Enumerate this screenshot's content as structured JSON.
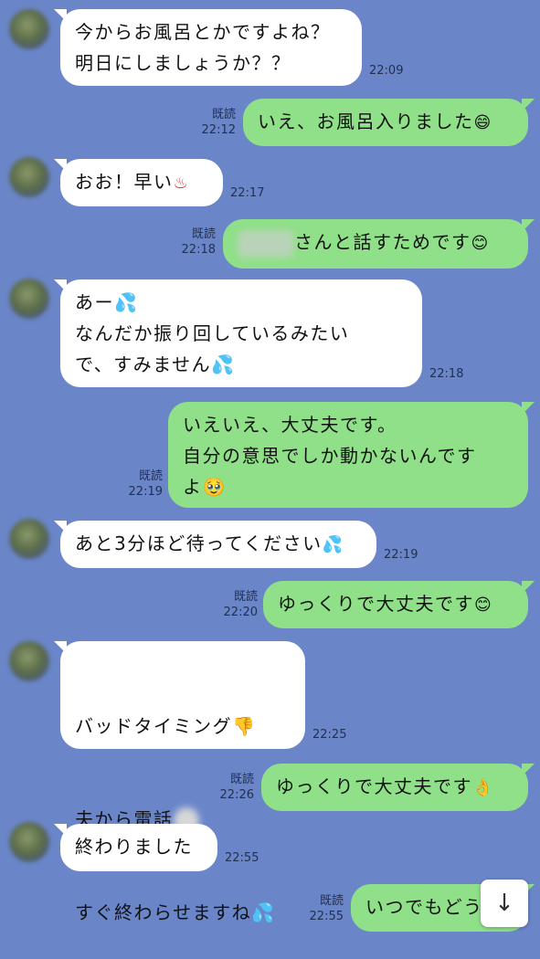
{
  "messages": [
    {
      "lines": "今からお風呂とかですよね？\n明日にしましょうか？？",
      "time": "22:09"
    },
    {
      "text": "いえ、お風呂入りました",
      "emoji": "😄",
      "read": "既読",
      "time": "22:12"
    },
    {
      "text": "おお！早い",
      "emoji": "♨",
      "time": "22:17"
    },
    {
      "text": "さんと話すためです",
      "emoji": "😊",
      "read": "既読",
      "time": "22:18"
    },
    {
      "lines": "あー💦\nなんだか振り回しているみたい\nで、すみません💦",
      "time": "22:18"
    },
    {
      "lines": "いえいえ、大丈夫です。\n自分の意思でしか動かないんです\nよ🥹",
      "read": "既読",
      "time": "22:19"
    },
    {
      "text": "あと3分ほど待ってください",
      "emoji": "💦",
      "time": "22:19"
    },
    {
      "text": "ゆっくりで大丈夫です",
      "emoji": "😊",
      "read": "既読",
      "time": "22:20"
    },
    {
      "line1": "バッドタイミング👎",
      "line2": "夫から電話",
      "line3": "すぐ終わらせますね💦",
      "time": "22:25"
    },
    {
      "text": "ゆっくりで大丈夫です",
      "emoji": "👌",
      "read": "既読",
      "time": "22:26"
    },
    {
      "text": "終わりました",
      "time": "22:55"
    },
    {
      "text": "いつでもどう",
      "read": "既読",
      "time": "22:55"
    }
  ],
  "scroll_button": {
    "icon": "↓"
  },
  "icons": {
    "avatar": "avatar-icon",
    "scroll": "arrow-down-icon"
  },
  "colors": {
    "background": "#6a86c9",
    "incoming": "#ffffff",
    "outgoing": "#8fe088"
  }
}
